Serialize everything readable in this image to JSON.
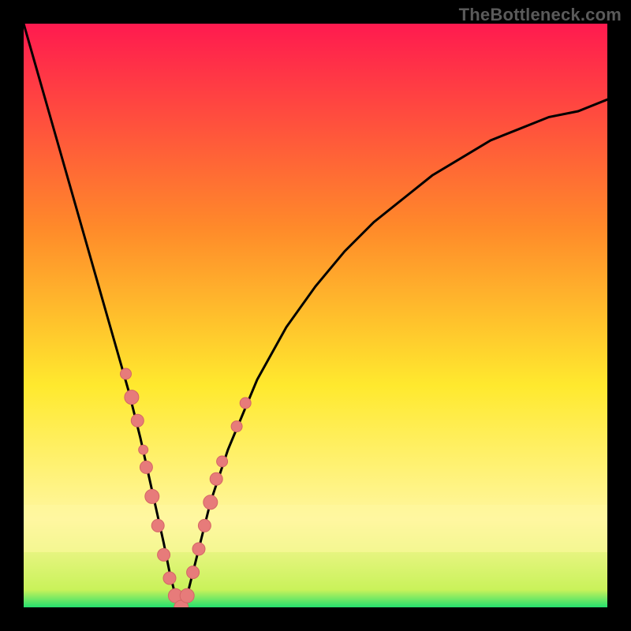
{
  "watermark": "TheBottleneck.com",
  "colors": {
    "frame": "#000000",
    "gradient_top": "#ff1a4f",
    "gradient_mid1": "#ff8a2a",
    "gradient_mid2": "#ffe92e",
    "gradient_band": "#fff7a0",
    "gradient_bottom": "#24e06e",
    "curve": "#000000",
    "marker_fill": "#e77b7a",
    "marker_stroke": "#d46665"
  },
  "chart_data": {
    "type": "line",
    "title": "",
    "xlabel": "",
    "ylabel": "",
    "xlim": [
      0,
      100
    ],
    "ylim": [
      0,
      100
    ],
    "x": [
      0,
      2,
      4,
      6,
      8,
      10,
      12,
      14,
      16,
      18,
      20,
      22,
      24,
      25,
      26,
      27,
      28,
      30,
      32,
      35,
      40,
      45,
      50,
      55,
      60,
      65,
      70,
      75,
      80,
      85,
      90,
      95,
      100
    ],
    "y": [
      100,
      93,
      86,
      79,
      72,
      65,
      58,
      51,
      44,
      37,
      29,
      20,
      11,
      6,
      2,
      0,
      2,
      10,
      18,
      27,
      39,
      48,
      55,
      61,
      66,
      70,
      74,
      77,
      80,
      82,
      84,
      85,
      87
    ],
    "minimum_x": 27,
    "note": "V-shaped bottleneck curve; y is bottleneck percentage (high = red/bad, low = green/good). Values estimated from pixel heights against vertical gradient; no axes or tick labels are visible."
  },
  "markers": [
    {
      "x": 17.5,
      "y": 40,
      "r": 7
    },
    {
      "x": 18.5,
      "y": 36,
      "r": 9
    },
    {
      "x": 19.5,
      "y": 32,
      "r": 8
    },
    {
      "x": 20.5,
      "y": 27,
      "r": 6
    },
    {
      "x": 21.0,
      "y": 24,
      "r": 8
    },
    {
      "x": 22.0,
      "y": 19,
      "r": 9
    },
    {
      "x": 23.0,
      "y": 14,
      "r": 8
    },
    {
      "x": 24.0,
      "y": 9,
      "r": 8
    },
    {
      "x": 25.0,
      "y": 5,
      "r": 8
    },
    {
      "x": 26.0,
      "y": 2,
      "r": 9
    },
    {
      "x": 27.0,
      "y": 0,
      "r": 9
    },
    {
      "x": 28.0,
      "y": 2,
      "r": 9
    },
    {
      "x": 29.0,
      "y": 6,
      "r": 8
    },
    {
      "x": 30.0,
      "y": 10,
      "r": 8
    },
    {
      "x": 31.0,
      "y": 14,
      "r": 8
    },
    {
      "x": 32.0,
      "y": 18,
      "r": 9
    },
    {
      "x": 33.0,
      "y": 22,
      "r": 8
    },
    {
      "x": 34.0,
      "y": 25,
      "r": 7
    },
    {
      "x": 36.5,
      "y": 31,
      "r": 7
    },
    {
      "x": 38.0,
      "y": 35,
      "r": 7
    }
  ]
}
